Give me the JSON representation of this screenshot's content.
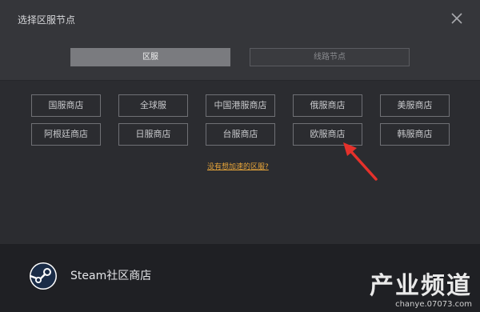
{
  "window": {
    "title": "选择区服节点"
  },
  "tabs": [
    {
      "label": "区服",
      "active": true
    },
    {
      "label": "线路节点",
      "active": false
    }
  ],
  "regions": [
    "国服商店",
    "全球服",
    "中国港服商店",
    "俄服商店",
    "美服商店",
    "阿根廷商店",
    "日服商店",
    "台服商店",
    "欧服商店",
    "韩服商店"
  ],
  "help_link": "没有想加速的区服?",
  "footer": {
    "store_name": "Steam社区商店",
    "logo_icon": "steam-logo-icon"
  },
  "watermark": {
    "main": "产业频道",
    "sub": "chanye.07073.com"
  },
  "colors": {
    "accent_link": "#e8a63a",
    "arrow": "#e5312b",
    "active_tab": "#7a7b7f"
  }
}
